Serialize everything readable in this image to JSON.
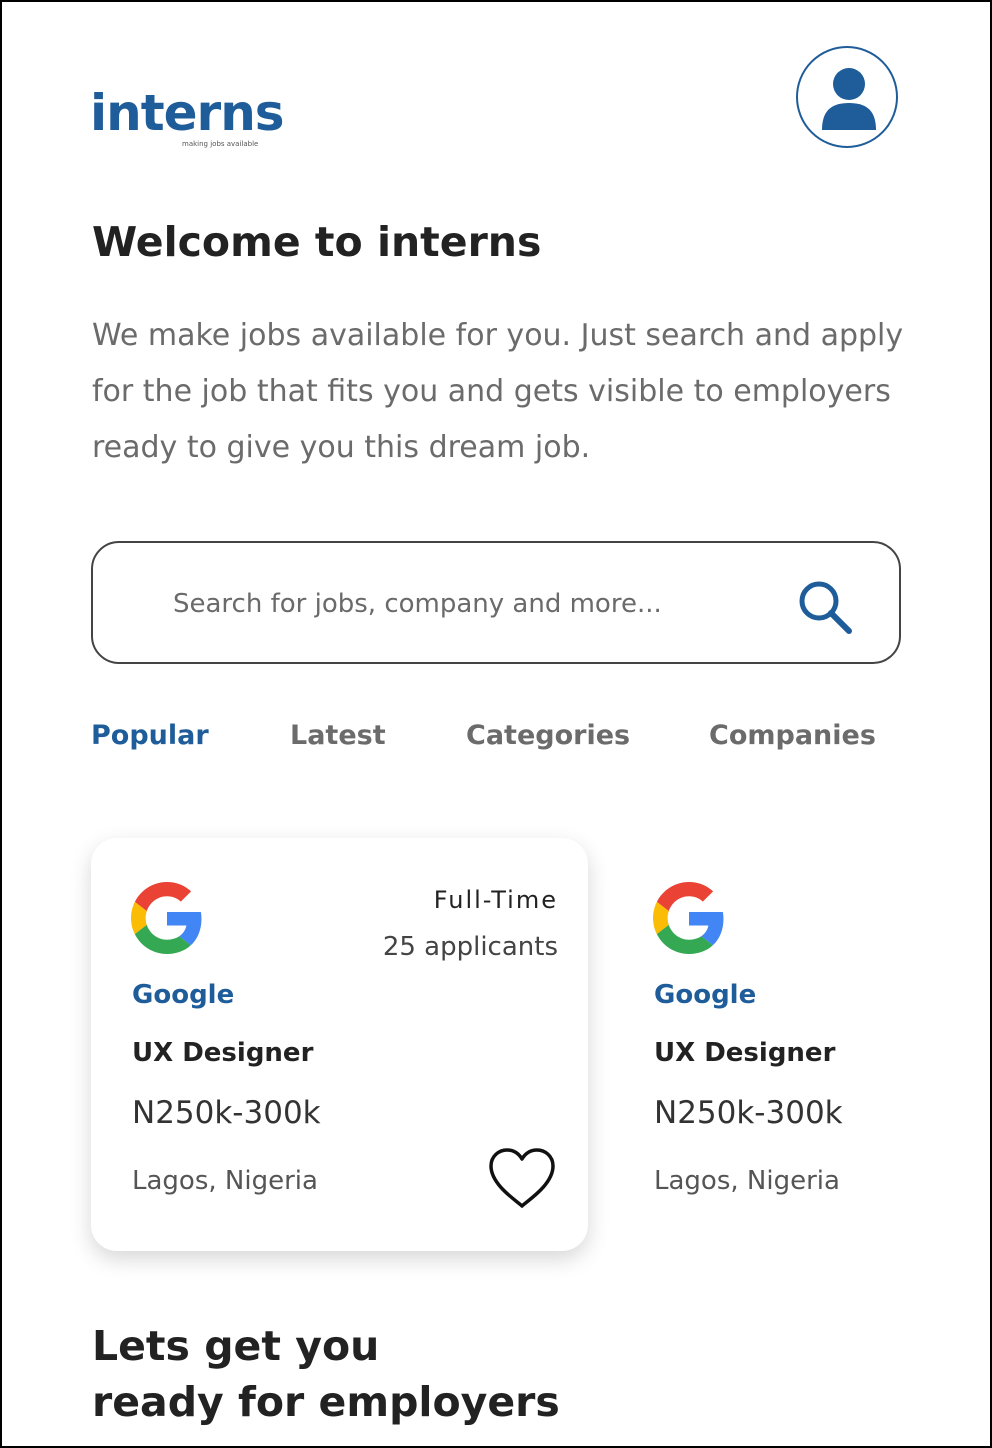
{
  "brand": {
    "name": "interns",
    "tagline": "making jobs available",
    "color": "#1e5c9a"
  },
  "header": {
    "profile_icon": "user-icon"
  },
  "hero": {
    "title": "Welcome to interns",
    "description": "We make jobs available for you. Just search and apply for the job that fits you and gets visible to employers ready to give you this dream job."
  },
  "search": {
    "placeholder": "Search for jobs, company and more...",
    "icon": "search-icon"
  },
  "tabs": [
    {
      "label": "Popular",
      "active": true
    },
    {
      "label": "Latest",
      "active": false
    },
    {
      "label": "Categories",
      "active": false
    },
    {
      "label": "Companies",
      "active": false
    }
  ],
  "jobs": [
    {
      "company": "Google",
      "role": "UX Designer",
      "salary": "N250k-300k",
      "location": "Lagos, Nigeria",
      "type": "Full-Time",
      "applicants": "25 applicants",
      "icon": "google-logo-icon"
    },
    {
      "company": "Google",
      "role": "UX Designer",
      "salary": "N250k-300k",
      "location": "Lagos, Nigeria",
      "icon": "google-logo-icon"
    }
  ],
  "section": {
    "title_line1": "Lets get you",
    "title_line2": "ready for employers"
  },
  "colors": {
    "accent": "#1e5c9a",
    "muted_text": "#6b6b6b"
  }
}
